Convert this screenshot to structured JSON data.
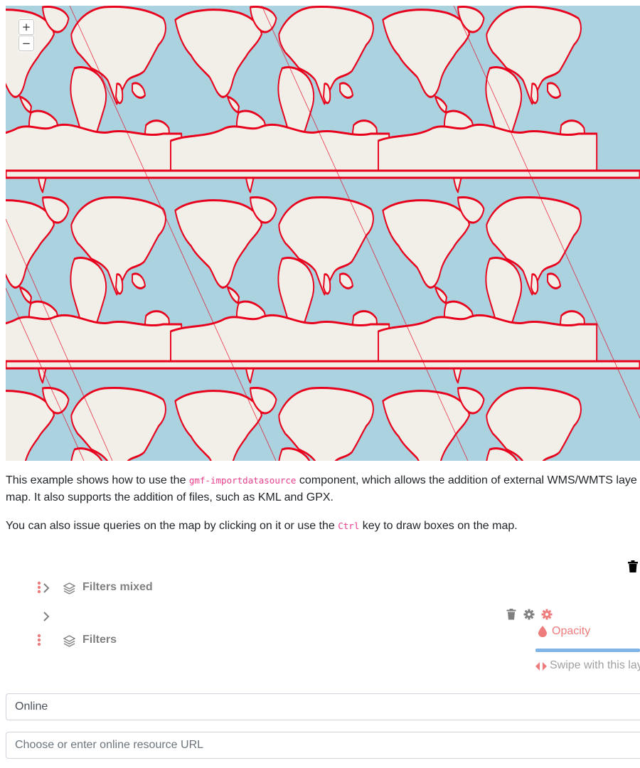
{
  "map": {
    "zoom_in": "+",
    "zoom_out": "−",
    "colors": {
      "water": "#aad3df",
      "land": "#f2efe9",
      "border": "#e8001c"
    }
  },
  "description": {
    "p1_before": "This example shows how to use the ",
    "p1_code": "gmf-importdatasource",
    "p1_after": " component, which allows the addition of external WMS/WMTS laye",
    "p1_line2": "map. It also supports the addition of files, such as KML and GPX.",
    "p2_before": "You can also issue queries on the map by clicking on it or use the ",
    "p2_code": "Ctrl",
    "p2_after": " key to draw boxes on the map."
  },
  "layertree": {
    "groups": [
      {
        "label": "Filters mixed"
      },
      {
        "label": "Filters"
      }
    ],
    "opacity_label": "Opacity",
    "swipe_label": "Swipe with this lay",
    "accent_color": "#ee7c7c"
  },
  "import": {
    "source_value": "Online",
    "url_placeholder": "Choose or enter online resource URL"
  }
}
